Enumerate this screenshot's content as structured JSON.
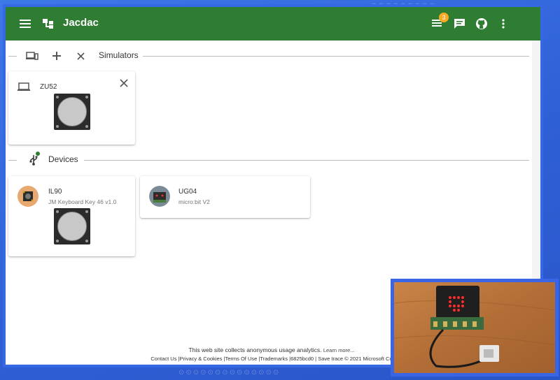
{
  "app": {
    "title": "Jacdac",
    "notification_count": "3",
    "icons": [
      "menu-icon",
      "logo-icon",
      "notifications-icon",
      "chat-icon",
      "github-icon",
      "more-vert-icon"
    ]
  },
  "simulators": {
    "label": "Simulators",
    "cards": [
      {
        "name": "ZU52",
        "icon": "laptop-icon"
      }
    ]
  },
  "devices": {
    "label": "Devices",
    "status_color": "#2e7d32",
    "cards": [
      {
        "name": "IL90",
        "description": "JM Keyboard Key 46 v1.0"
      },
      {
        "name": "UG04",
        "description": "micro:bit V2"
      }
    ]
  },
  "footer": {
    "analytics_text": "This web site collects anonymous usage analytics.",
    "learn_more": "Learn more...",
    "links": [
      "Contact Us",
      "Privacy & Cookies",
      "Terms Of Use",
      "Trademarks",
      "6825bcd0",
      "Save trace",
      "© 2021 Microsoft Co"
    ]
  },
  "colors": {
    "appbar": "#2e7d32",
    "frame_border": "#3569e4",
    "badge": "#f9a825"
  }
}
